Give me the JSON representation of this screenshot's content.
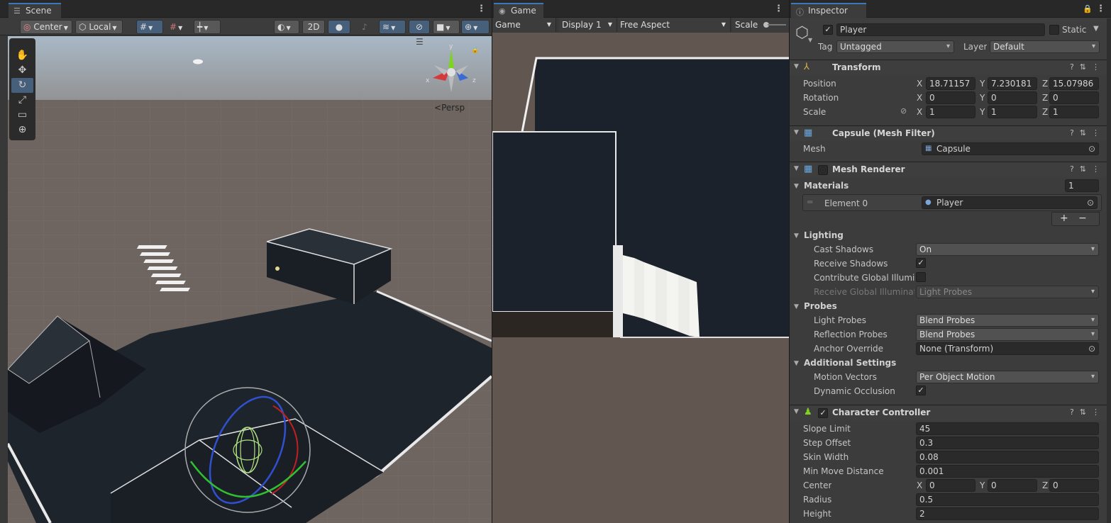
{
  "colors": {
    "accent": "#3a79bb",
    "active_button": "#46607c",
    "sky_top": "#b8c3cc",
    "ground": "#6e6560",
    "game_bg": "#615650",
    "dark_mesh": "#1e242c"
  },
  "scene": {
    "tab_label": "Scene",
    "tab_icon": "scene-icon",
    "pivot_label": "Center",
    "space_label": "Local",
    "twod_label": "2D",
    "persp_label": "Persp",
    "gizmo_axes": {
      "x": "x",
      "y": "y",
      "z": "z"
    },
    "tools": [
      "view-tool",
      "move-tool",
      "rotate-tool",
      "scale-tool",
      "rect-tool",
      "transform-tool"
    ]
  },
  "game": {
    "tab_label": "Game",
    "display_mode": "Game",
    "display": "Display 1",
    "aspect": "Free Aspect",
    "scale_label": "Scale"
  },
  "inspector": {
    "tab_label": "Inspector",
    "object_name": "Player",
    "static_label": "Static",
    "tag_label": "Tag",
    "tag_value": "Untagged",
    "layer_label": "Layer",
    "layer_value": "Default",
    "transform": {
      "title": "Transform",
      "position_label": "Position",
      "rotation_label": "Rotation",
      "scale_label": "Scale",
      "position": {
        "x": "18.71157",
        "y": "7.230181",
        "z": "15.07986"
      },
      "rotation": {
        "x": "0",
        "y": "0",
        "z": "0"
      },
      "scale": {
        "x": "1",
        "y": "1",
        "z": "1"
      }
    },
    "mesh_filter": {
      "title": "Capsule (Mesh Filter)",
      "mesh_label": "Mesh",
      "mesh_value": "Capsule"
    },
    "mesh_renderer": {
      "title": "Mesh Renderer",
      "materials_label": "Materials",
      "materials_count": "1",
      "element0_label": "Element 0",
      "element0_value": "Player",
      "add_label": "+",
      "remove_label": "−",
      "lighting_label": "Lighting",
      "cast_shadows_label": "Cast Shadows",
      "cast_shadows_value": "On",
      "receive_shadows_label": "Receive Shadows",
      "contribute_gi_label": "Contribute Global Illumina",
      "receive_gi_label": "Receive Global Illuminatic",
      "receive_gi_value": "Light Probes",
      "probes_label": "Probes",
      "light_probes_label": "Light Probes",
      "light_probes_value": "Blend Probes",
      "reflection_probes_label": "Reflection Probes",
      "reflection_probes_value": "Blend Probes",
      "anchor_override_label": "Anchor Override",
      "anchor_override_value": "None (Transform)",
      "additional_label": "Additional Settings",
      "motion_vectors_label": "Motion Vectors",
      "motion_vectors_value": "Per Object Motion",
      "dynamic_occlusion_label": "Dynamic Occlusion"
    },
    "character_controller": {
      "title": "Character Controller",
      "slope_limit_label": "Slope Limit",
      "slope_limit": "45",
      "step_offset_label": "Step Offset",
      "step_offset": "0.3",
      "skin_width_label": "Skin Width",
      "skin_width": "0.08",
      "min_move_label": "Min Move Distance",
      "min_move": "0.001",
      "center_label": "Center",
      "center": {
        "x": "0",
        "y": "0",
        "z": "0"
      },
      "radius_label": "Radius",
      "radius": "0.5",
      "height_label": "Height",
      "height": "2"
    },
    "axis_labels": {
      "x": "X",
      "y": "Y",
      "z": "Z"
    }
  }
}
